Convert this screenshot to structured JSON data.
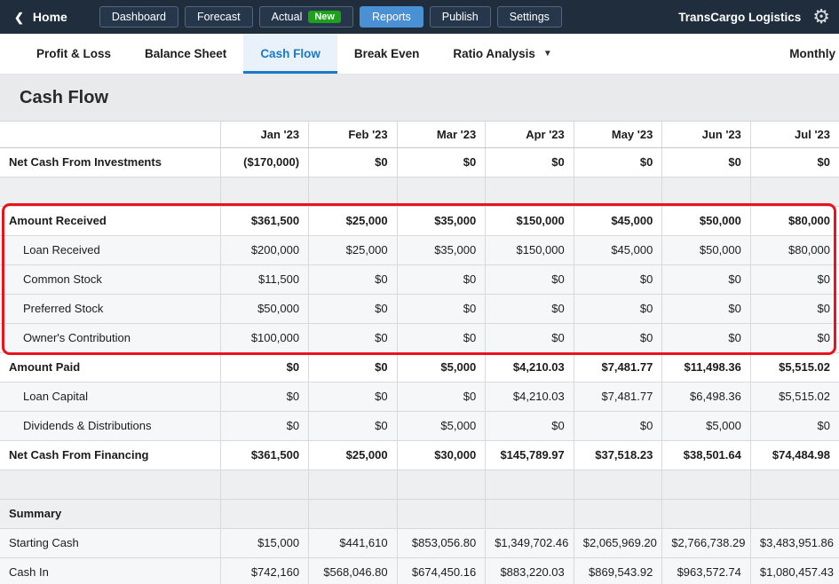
{
  "topbar": {
    "home_label": "Home",
    "brand": "TransCargo Logistics",
    "nav": [
      {
        "label": "Dashboard",
        "active": false
      },
      {
        "label": "Forecast",
        "active": false
      },
      {
        "label": "Actual",
        "badge": "New",
        "active": false
      },
      {
        "label": "Reports",
        "active": true
      },
      {
        "label": "Publish",
        "active": false
      },
      {
        "label": "Settings",
        "active": false
      }
    ]
  },
  "tabs": {
    "items": [
      {
        "label": "Profit & Loss",
        "active": false,
        "caret": false
      },
      {
        "label": "Balance Sheet",
        "active": false,
        "caret": false
      },
      {
        "label": "Cash Flow",
        "active": true,
        "caret": false
      },
      {
        "label": "Break Even",
        "active": false,
        "caret": false
      },
      {
        "label": "Ratio Analysis",
        "active": false,
        "caret": true
      }
    ],
    "period_selector": "Monthly"
  },
  "page": {
    "title": "Cash Flow"
  },
  "colors": {
    "topbar_bg": "#1f2d3d",
    "nav_active_blue": "#4a90d5",
    "badge_green": "#1da11d",
    "tab_active_blue": "#1b79c8",
    "annotation_red": "#e8131b"
  },
  "table": {
    "columns": [
      "Jan '23",
      "Feb '23",
      "Mar '23",
      "Apr '23",
      "May '23",
      "Jun '23",
      "Jul '23"
    ],
    "rows": [
      {
        "type": "bold",
        "label": "Net Cash From Investments",
        "values": [
          "($170,000)",
          "$0",
          "$0",
          "$0",
          "$0",
          "$0",
          "$0"
        ]
      },
      {
        "type": "spacer",
        "label": "",
        "values": []
      },
      {
        "type": "bold",
        "label": "Amount Received",
        "values": [
          "$361,500",
          "$25,000",
          "$35,000",
          "$150,000",
          "$45,000",
          "$50,000",
          "$80,000"
        ]
      },
      {
        "type": "sub",
        "label": "Loan Received",
        "values": [
          "$200,000",
          "$25,000",
          "$35,000",
          "$150,000",
          "$45,000",
          "$50,000",
          "$80,000"
        ]
      },
      {
        "type": "sub",
        "label": "Common Stock",
        "values": [
          "$11,500",
          "$0",
          "$0",
          "$0",
          "$0",
          "$0",
          "$0"
        ]
      },
      {
        "type": "sub",
        "label": "Preferred Stock",
        "values": [
          "$50,000",
          "$0",
          "$0",
          "$0",
          "$0",
          "$0",
          "$0"
        ]
      },
      {
        "type": "sub",
        "label": "Owner's Contribution",
        "values": [
          "$100,000",
          "$0",
          "$0",
          "$0",
          "$0",
          "$0",
          "$0"
        ]
      },
      {
        "type": "bold",
        "label": "Amount Paid",
        "values": [
          "$0",
          "$0",
          "$5,000",
          "$4,210.03",
          "$7,481.77",
          "$11,498.36",
          "$5,515.02"
        ]
      },
      {
        "type": "sub",
        "label": "Loan Capital",
        "values": [
          "$0",
          "$0",
          "$0",
          "$4,210.03",
          "$7,481.77",
          "$6,498.36",
          "$5,515.02"
        ]
      },
      {
        "type": "sub",
        "label": "Dividends & Distributions",
        "values": [
          "$0",
          "$0",
          "$5,000",
          "$0",
          "$0",
          "$5,000",
          "$0"
        ]
      },
      {
        "type": "bold",
        "label": "Net Cash From Financing",
        "values": [
          "$361,500",
          "$25,000",
          "$30,000",
          "$145,789.97",
          "$37,518.23",
          "$38,501.64",
          "$74,484.98"
        ]
      },
      {
        "type": "spacer",
        "label": "",
        "values": []
      },
      {
        "type": "section",
        "label": "Summary",
        "values": []
      },
      {
        "type": "normal",
        "label": "Starting Cash",
        "values": [
          "$15,000",
          "$441,610",
          "$853,056.80",
          "$1,349,702.46",
          "$2,065,969.20",
          "$2,766,738.29",
          "$3,483,951.86"
        ]
      },
      {
        "type": "normal",
        "label": "Cash In",
        "values": [
          "$742,160",
          "$568,046.80",
          "$674,450.16",
          "$883,220.03",
          "$869,543.92",
          "$963,572.74",
          "$1,080,457.43"
        ]
      }
    ]
  }
}
